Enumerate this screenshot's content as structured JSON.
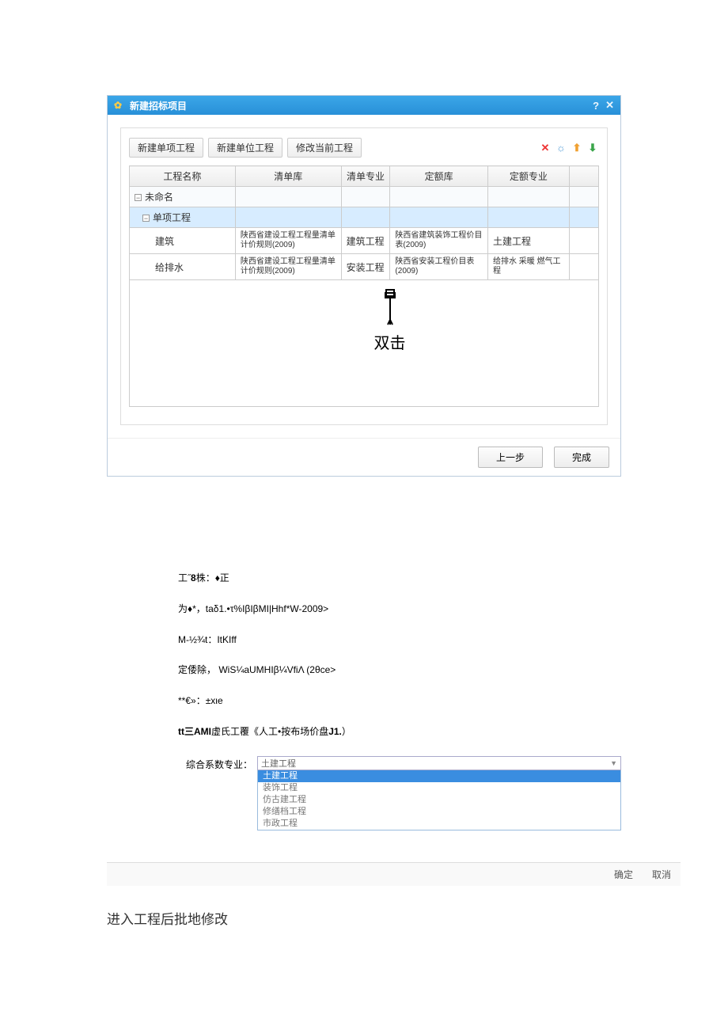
{
  "dialog1": {
    "title": "新建招标项目",
    "toolbar": {
      "btn1": "新建单项工程",
      "btn2": "新建单位工程",
      "btn3": "修改当前工程"
    },
    "columns": {
      "name": "工程名称",
      "lib1": "清单库",
      "prof1": "清单专业",
      "lib2": "定额库",
      "prof2": "定额专业"
    },
    "rows": {
      "root": "未命名",
      "group": "单项工程",
      "r1": {
        "name": "建筑",
        "lib1": "陕西省建设工程工程量清单计价规则(2009)",
        "prof1": "建筑工程",
        "lib2": "陕西省建筑装饰工程价目表(2009)",
        "prof2": "土建工程"
      },
      "r2": {
        "name": "给排水",
        "lib1": "陕西省建设工程工程量清单计价规则(2009)",
        "prof1": "安装工程",
        "lib2": "陕西省安装工程价目表(2009)",
        "prof2": "给排水 采暖 燃气工程"
      }
    },
    "annotation": "双击",
    "footer": {
      "prev": "上一步",
      "finish": "完成"
    }
  },
  "middle": {
    "l1_a": "工˝",
    "l1_b": "8",
    "l1_c": "株：♦正",
    "l2": "为♦*，taδ1.•τ%IβIβMI|Hhf*W-2009>",
    "l3": "M-½¾t：ItKIff",
    "l4": "定倭除， WiS¼aUMHIβ¼VfiΛ (2θce>",
    "l5": "**€»：±xιe",
    "l6_a": "tt三AMI",
    "l6_b": "虚氏工覆《人工•按布场价盘",
    "l6_c": "J1.",
    "l6_d": "）"
  },
  "combo": {
    "label": "综合系数专业：",
    "value": "土建工程",
    "options": [
      "土建工程",
      "装饰工程",
      "仿古建工程",
      "修缮档工程",
      "市政工程"
    ]
  },
  "lowerFooter": {
    "ok": "确定",
    "cancel": "取消"
  },
  "finalLine": "进入工程后批地修改"
}
